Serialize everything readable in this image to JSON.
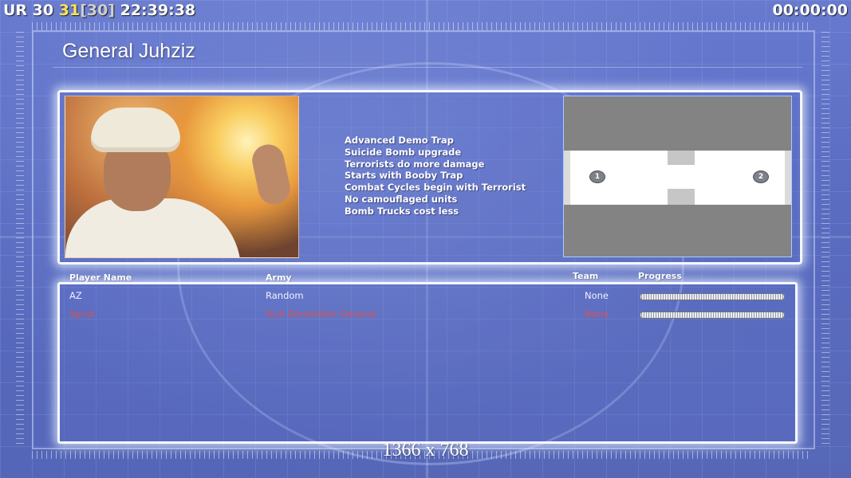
{
  "hud": {
    "left_prefix": "UR 30 ",
    "left_highlight": "31",
    "left_bracket": "[30]",
    "left_time": " 22:39:38",
    "right_timer": "00:00:00"
  },
  "general": {
    "title": "General Juhziz",
    "traits": [
      "Advanced Demo Trap",
      "Suicide Bomb upgrade",
      "Terrorists do more damage",
      "Starts with Booby Trap",
      "Combat Cycles begin with Terrorist",
      "No camouflaged units",
      "Bomb Trucks cost less"
    ]
  },
  "map": {
    "start_positions": [
      "1",
      "2"
    ]
  },
  "table": {
    "headers": {
      "player_name": "Player Name",
      "army": "Army",
      "team": "Team",
      "progress": "Progress"
    },
    "players": [
      {
        "name": "AZ",
        "army": "Random",
        "team": "None",
        "color": "#eef0ff",
        "progress": 1.0
      },
      {
        "name": "Sprut",
        "army": "GLA Demolition General",
        "team": "None",
        "color": "#d7393a",
        "progress": 1.0
      }
    ]
  },
  "resolution_label": "1366 x 768",
  "colors": {
    "highlight_yellow": "#f5e23c",
    "player2_red": "#d7393a",
    "background_blue": "#4a5fc0"
  }
}
